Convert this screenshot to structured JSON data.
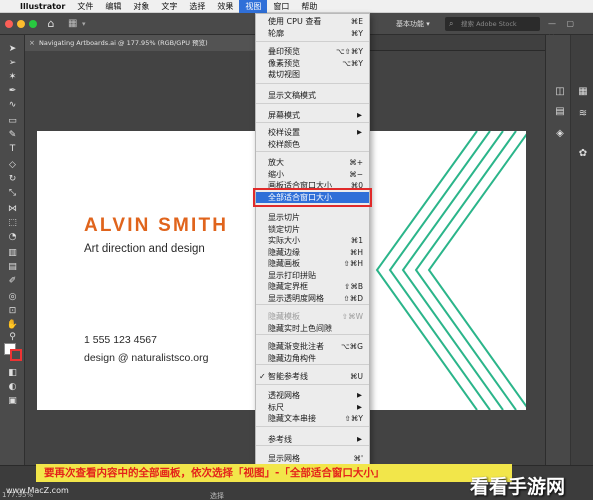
{
  "menubar": {
    "items": [
      "Illustrator",
      "文件",
      "编辑",
      "对象",
      "文字",
      "选择",
      "效果",
      "视图",
      "窗口",
      "帮助"
    ],
    "active_index": 7
  },
  "appbar": {
    "workspace": "基本功能",
    "workspace_caret": "▾",
    "search_placeholder": "搜索 Adobe Stock"
  },
  "document": {
    "tab_title": "Navigating Artboards.ai @ 177.95% (RGB/GPU 预览)"
  },
  "artboard": {
    "name": "ALVIN SMITH",
    "role": "Art direction and design",
    "phone": "1 555 123 4567",
    "email": "design @ naturalistsco.org",
    "accent_color": "#e0641c",
    "line_color": "#2bb58a"
  },
  "view_menu": {
    "items": [
      {
        "label": "使用 CPU 查看",
        "shortcut": "⌘E"
      },
      {
        "label": "轮廓",
        "shortcut": "⌘Y"
      },
      {
        "label": "叠印预览",
        "shortcut": "⌥⇧⌘Y"
      },
      {
        "label": "像素预览",
        "shortcut": "⌥⌘Y"
      },
      {
        "label": "裁切视图",
        "shortcut": ""
      },
      {
        "label": "显示文稿模式",
        "shortcut": ""
      },
      {
        "label": "屏幕模式",
        "shortcut": "▶"
      },
      {
        "label": "校样设置",
        "shortcut": "▶"
      },
      {
        "label": "校样颜色",
        "shortcut": ""
      },
      {
        "label": "放大",
        "shortcut": "⌘+"
      },
      {
        "label": "缩小",
        "shortcut": "⌘−"
      },
      {
        "label": "画板适合窗口大小",
        "shortcut": "⌘0"
      },
      {
        "label": "全部适合窗口大小",
        "shortcut": ""
      },
      {
        "label": "显示切片",
        "shortcut": ""
      },
      {
        "label": "锁定切片",
        "shortcut": ""
      },
      {
        "label": "实际大小",
        "shortcut": "⌘1"
      },
      {
        "label": "隐藏边缘",
        "shortcut": "⌘H"
      },
      {
        "label": "隐藏画板",
        "shortcut": "⇧⌘H"
      },
      {
        "label": "显示打印拼贴",
        "shortcut": ""
      },
      {
        "label": "隐藏定界框",
        "shortcut": "⇧⌘B"
      },
      {
        "label": "显示透明度网格",
        "shortcut": "⇧⌘D"
      },
      {
        "label": "隐藏模板",
        "shortcut": "⇧⌘W"
      },
      {
        "label": "隐藏实时上色间隙",
        "shortcut": ""
      },
      {
        "label": "隐藏渐变批注者",
        "shortcut": "⌥⌘G"
      },
      {
        "label": "隐藏边角构件",
        "shortcut": ""
      },
      {
        "label": "智能参考线",
        "shortcut": "⌘U"
      },
      {
        "label": "透视网格",
        "shortcut": "▶"
      },
      {
        "label": "标尺",
        "shortcut": "▶"
      },
      {
        "label": "隐藏文本串接",
        "shortcut": "⇧⌘Y"
      },
      {
        "label": "参考线",
        "shortcut": "▶"
      },
      {
        "label": "显示网格",
        "shortcut": "⌘'"
      }
    ],
    "highlighted_item": "全部适合窗口大小",
    "checked_item": "智能参考线",
    "disabled_item": "隐藏模板"
  },
  "status": {
    "zoom": "177.95%",
    "tool": "选择"
  },
  "caption": {
    "text": "要再次查看内容中的全部画板，依次选择「视图」-「全部适合窗口大小」"
  },
  "watermark": {
    "url": "www.MacZ.com",
    "logo": "看看手游网"
  },
  "colors": {
    "menu_highlight": "#2f6fd8",
    "callout_red": "#e02a2a",
    "caption_bg": "#f2e64a",
    "caption_text": "#e4231a"
  }
}
